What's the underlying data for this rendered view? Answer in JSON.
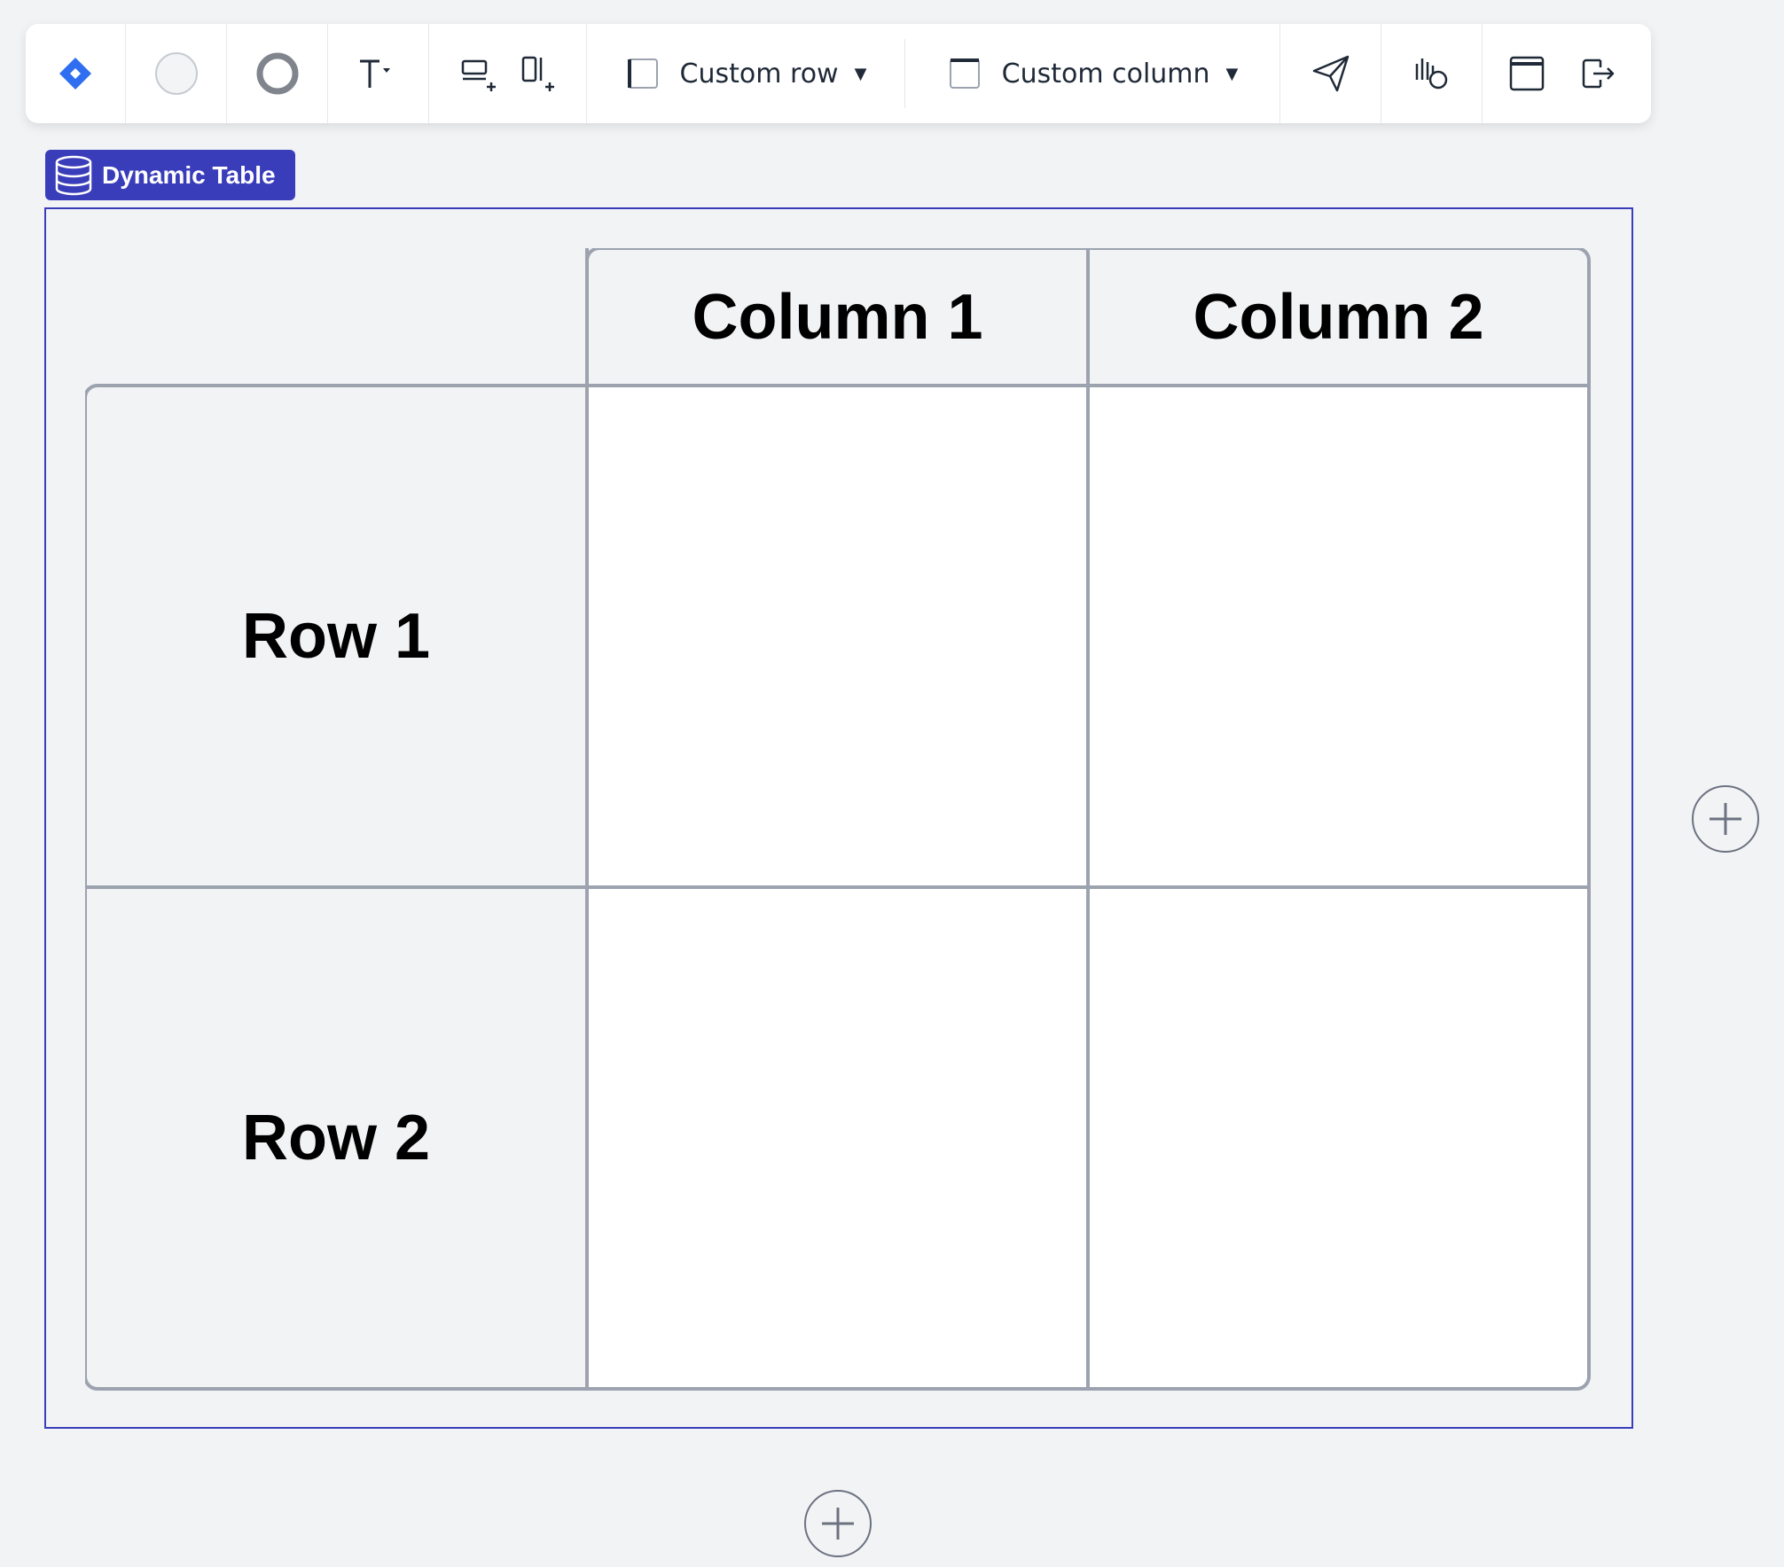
{
  "toolbar": {
    "row_dropdown_label": "Custom row",
    "column_dropdown_label": "Custom column",
    "icons": {
      "app_logo": "diamond-logo-icon",
      "fill_color": "fill-color-icon",
      "border_color": "border-color-icon",
      "text_format": "text-format-icon",
      "add_row": "add-row-icon",
      "add_column": "add-column-icon",
      "row_style": "row-style-icon",
      "column_style": "column-style-icon",
      "send": "send-icon",
      "interaction": "interaction-icon",
      "window": "window-icon",
      "exit": "exit-icon"
    }
  },
  "widget": {
    "label": "Dynamic Table",
    "icon": "database-icon",
    "accent_color": "#3a3dba"
  },
  "table": {
    "columns": [
      "Column 1",
      "Column 2"
    ],
    "rows": [
      "Row 1",
      "Row 2"
    ],
    "cells": [
      [
        "",
        ""
      ],
      [
        "",
        ""
      ]
    ]
  },
  "add_buttons": {
    "add_column": "plus-icon",
    "add_row": "plus-icon"
  }
}
